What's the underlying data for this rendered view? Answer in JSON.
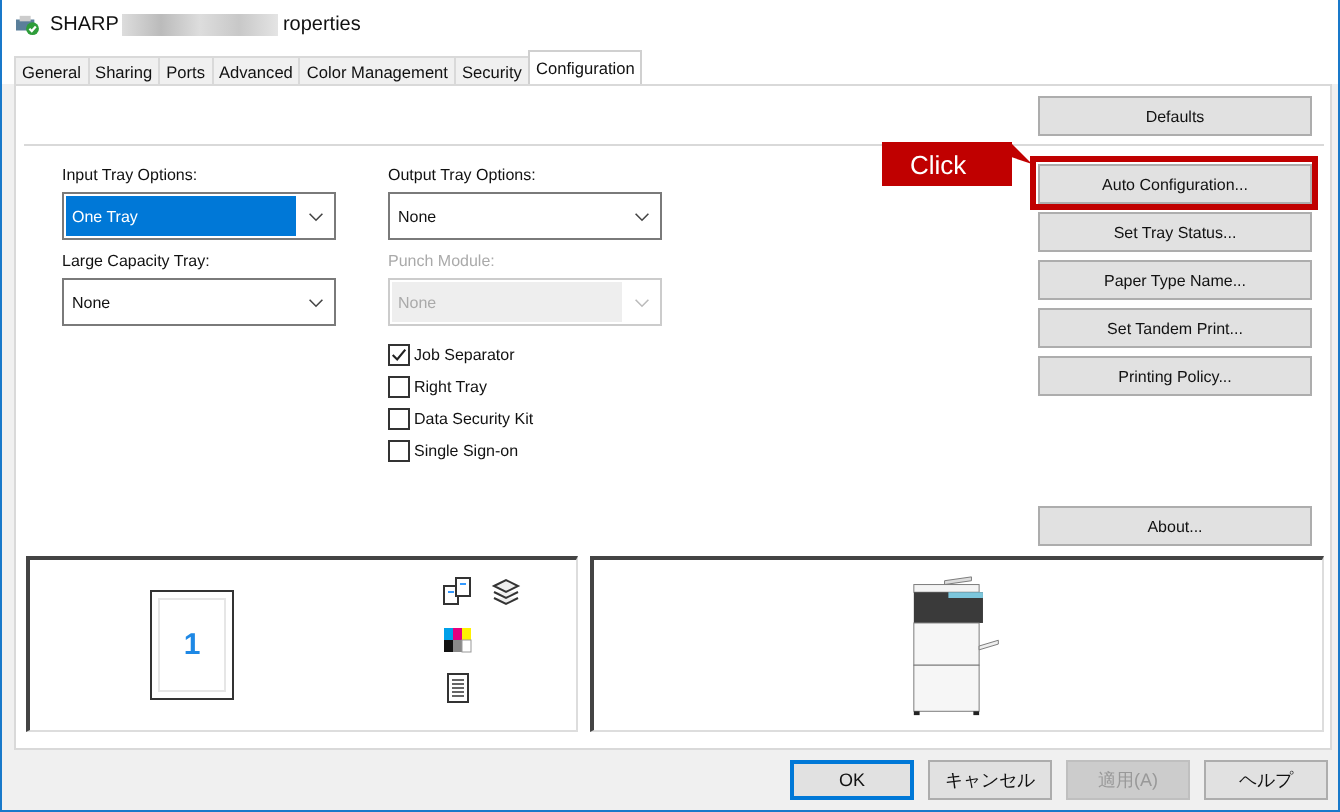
{
  "window": {
    "title_start": "SHARP",
    "title_end": "roperties"
  },
  "tabs": [
    {
      "label": "General",
      "selected": false
    },
    {
      "label": "Sharing",
      "selected": false
    },
    {
      "label": "Ports",
      "selected": false
    },
    {
      "label": "Advanced",
      "selected": false
    },
    {
      "label": "Color Management",
      "selected": false
    },
    {
      "label": "Security",
      "selected": false
    },
    {
      "label": "Configuration",
      "selected": true
    }
  ],
  "left_selects": [
    {
      "label": "Input Tray Options:",
      "value": "One Tray",
      "highlighted": true,
      "disabled": false
    },
    {
      "label": "Large Capacity Tray:",
      "value": "None",
      "highlighted": false,
      "disabled": false
    }
  ],
  "right_selects": [
    {
      "label": "Output Tray Options:",
      "value": "None",
      "highlighted": false,
      "disabled": false
    },
    {
      "label": "Punch Module:",
      "value": "None",
      "highlighted": false,
      "disabled": true
    }
  ],
  "checkboxes": [
    {
      "label": "Job Separator",
      "checked": true
    },
    {
      "label": "Right Tray",
      "checked": false
    },
    {
      "label": "Data Security Kit",
      "checked": false
    },
    {
      "label": "Single Sign-on",
      "checked": false
    }
  ],
  "defaults_button": "Defaults",
  "side_buttons": [
    {
      "label": "Auto Configuration...",
      "callout": "Click"
    },
    {
      "label": "Set Tray Status..."
    },
    {
      "label": "Paper Type Name..."
    },
    {
      "label": "Set Tandem Print..."
    },
    {
      "label": "Printing Policy..."
    }
  ],
  "about_button": "About...",
  "preview": {
    "page_number": "1"
  },
  "dialog_buttons": [
    {
      "label": "OK",
      "default": true,
      "disabled": false
    },
    {
      "label": "キャンセル",
      "default": false,
      "disabled": false
    },
    {
      "label": "適用(A)",
      "default": false,
      "disabled": true
    },
    {
      "label": "ヘルプ",
      "default": false,
      "disabled": false
    }
  ]
}
